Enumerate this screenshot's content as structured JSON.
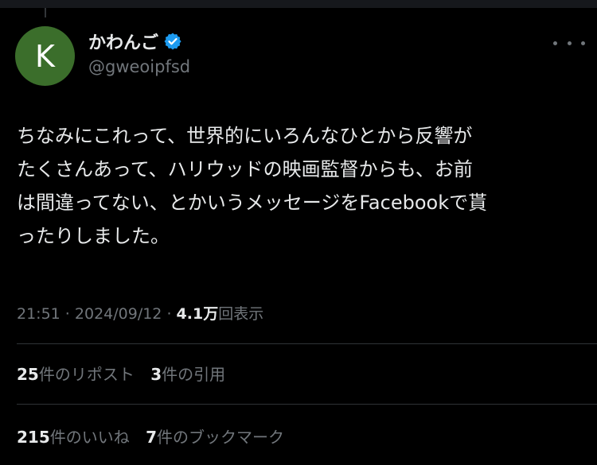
{
  "author": {
    "avatar_letter": "K",
    "avatar_color": "#3b6e2b",
    "display_name": "かわんご",
    "handle": "@gweoipfsd",
    "verified": true,
    "verified_color": "#1d9bf0"
  },
  "tweet": {
    "lines": [
      "ちなみにこれって、世界的にいろんなひとから反響が",
      "たくさんあって、ハリウッドの映画監督からも、お前",
      "は間違ってない、とかいうメッセージをFacebookで貰",
      "ったりしました。"
    ]
  },
  "meta": {
    "time": "21:51",
    "separator": " · ",
    "date": "2024/09/12",
    "views_count": "4.1万",
    "views_label": "回表示"
  },
  "stats": {
    "reposts_count": "25",
    "reposts_label": "件のリポスト",
    "quotes_count": "3",
    "quotes_label": "件の引用",
    "likes_count": "215",
    "likes_label": "件のいいね",
    "bookmarks_count": "7",
    "bookmarks_label": "件のブックマーク"
  },
  "icons": [
    "verified-badge-icon",
    "more-options-icon"
  ],
  "colors": {
    "background": "#000000",
    "text_primary": "#e7e9ea",
    "text_secondary": "#71767b",
    "divider": "#2f3336"
  }
}
